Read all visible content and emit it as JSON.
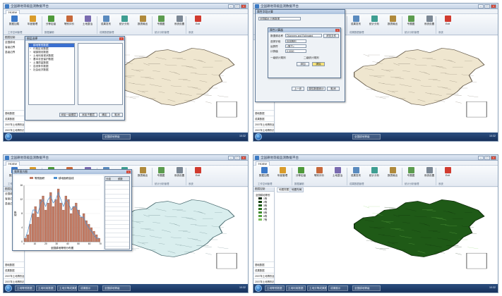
{
  "app": {
    "title": "全国耕地等级监测数据平台",
    "menu_tab": "Home",
    "taskbar_item": "全国耕地等级",
    "tray_time": "10:32"
  },
  "ribbon": {
    "buttons": [
      {
        "label": "数据加载",
        "icon": "folder-icon",
        "color": "#3c79c8"
      },
      {
        "label": "年度管理",
        "icon": "calendar-icon",
        "color": "#d99c2b"
      },
      {
        "label": "分等定级",
        "icon": "layers-icon",
        "color": "#4f9a3b"
      },
      {
        "label": "等别评价",
        "icon": "user-icon",
        "color": "#c7683a"
      },
      {
        "label": "土地整治",
        "icon": "tools-icon",
        "color": "#7a6bb0"
      },
      {
        "label": "成果发布",
        "icon": "document-icon",
        "color": "#5a8bbf"
      },
      {
        "label": "统计分析",
        "icon": "chart-icon",
        "color": "#3e9e92"
      },
      {
        "label": "报表输出",
        "icon": "report-icon",
        "color": "#b08a3c"
      },
      {
        "label": "专题图",
        "icon": "map-icon",
        "color": "#5c9c4f"
      },
      {
        "label": "系统设置",
        "icon": "gear-icon",
        "color": "#7b8794"
      },
      {
        "label": "Exit",
        "icon": "exit-icon",
        "color": "#d13b2f"
      }
    ],
    "groups": [
      "工作空间管理",
      "数据编辑",
      "成果数据管理",
      "统计分析管理",
      "系统"
    ]
  },
  "left_pane": {
    "tab_label": "图层控制",
    "items": [
      "全国耕地",
      "省级边界",
      "县级边界"
    ],
    "bottom_items": [
      "基础数据",
      "成果数据",
      "2007年土地等别(面)",
      "2007年土地等别(行政区)"
    ]
  },
  "panels": [
    {
      "id": "p1",
      "dialog_title": "图层选择",
      "tree_items": [
        "耕地等别数据",
        "行政区划数据",
        "城镇规划数据",
        "土地利用现状数据",
        "基本农田保护数据",
        "土壤质量数据",
        "自然条件数据",
        "社会经济数据"
      ],
      "buttons": [
        "添加一级图层",
        "添加子图层",
        "确定",
        "取消"
      ]
    },
    {
      "id": "p2",
      "outer_dialog_title": "属性字段计算",
      "outer_field": "全国耕地 分等数据",
      "dialog_title": "属性计算器",
      "expression_label": "数据源名称",
      "expression_value": "Otonnees and Estimated",
      "expression_btn": "浏览文件",
      "fields": [
        {
          "label": "选择字段",
          "value": "利用等别"
        },
        {
          "label": "运算符",
          "value": "<等于>"
        },
        {
          "label": "计算值",
          "value": "0.0000"
        }
      ],
      "check_a": "一级统计规则",
      "check_b": "二级统计规则",
      "buttons": [
        "添加",
        "清除",
        "上一步",
        "属性数据统计",
        "取消"
      ]
    },
    {
      "id": "p3",
      "dialog_title": "频率直方图",
      "legend": [
        "等别面积",
        "耕地面积曲线"
      ],
      "xlabel": "全国耕地等别分布图",
      "ylabel": "频率",
      "table_headers": [
        "分组",
        "频数"
      ],
      "taskbar_tabs": [
        "土地等别数据",
        "土地利用数据",
        "土地分等成果数据",
        "成果展示"
      ]
    },
    {
      "id": "p4",
      "map_tabs": [
        "地图视图",
        "地图布局"
      ],
      "legend_title": "全国耕地等别",
      "legend_items": [
        "1等",
        "2等",
        "3等",
        "4等",
        "5等",
        "6等",
        "7等"
      ],
      "taskbar_tabs": [
        "土地等别数据",
        "土地利用数据",
        "土地分等成果数据",
        "成果展示"
      ]
    }
  ],
  "chart_data": {
    "type": "bar",
    "title": "频率直方图",
    "xlabel": "全国耕地等别分布图",
    "ylabel": "频率",
    "ylim": [
      0,
      16
    ],
    "xlim": [
      0,
      70
    ],
    "series": [
      {
        "name": "等别面积",
        "values": [
          1,
          2,
          5,
          8,
          10,
          7,
          12,
          13,
          9,
          11,
          14,
          10,
          12,
          15,
          11,
          9,
          13,
          12,
          8,
          10,
          11,
          9,
          7,
          8,
          6,
          5,
          4,
          3,
          2,
          1
        ]
      },
      {
        "name": "耕地面积曲线",
        "values": [
          1,
          3,
          6,
          9,
          9,
          8,
          11,
          12,
          10,
          12,
          13,
          11,
          12,
          14,
          12,
          10,
          12,
          11,
          9,
          10,
          10,
          8,
          7,
          7,
          5,
          4,
          3,
          2,
          1,
          1
        ]
      }
    ],
    "colors": {
      "bar": "#c27a63",
      "line": "#4a8fcf"
    }
  }
}
